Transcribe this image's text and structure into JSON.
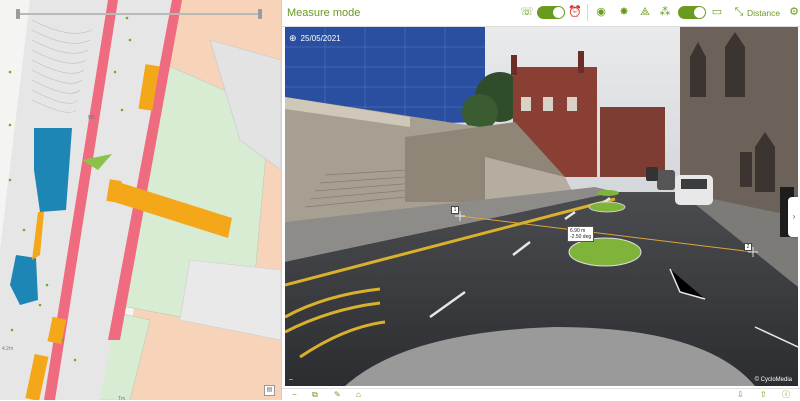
{
  "viewer": {
    "title": "Measure mode",
    "distance_label": "Distance",
    "date": "25/05/2021",
    "copyright": "© CycloMedia",
    "measurement": {
      "distance": "6.90 m",
      "slope": "-2.50 deg"
    },
    "points": [
      "1",
      "2"
    ],
    "toggles": [
      {
        "name": "toggle-1",
        "state": "on"
      },
      {
        "name": "toggle-2",
        "state": "on"
      }
    ]
  },
  "map": {
    "labels": [
      "M5",
      "4.2m",
      "Tm"
    ]
  },
  "colors": {
    "accent": "#6a9a1f",
    "map_road": "#e6e6e6",
    "map_red": "#ef6b7f",
    "map_orange": "#f3a719",
    "map_green": "#d7ecd3",
    "map_peach": "#f7d3b9",
    "map_blue": "#1e86b5"
  }
}
